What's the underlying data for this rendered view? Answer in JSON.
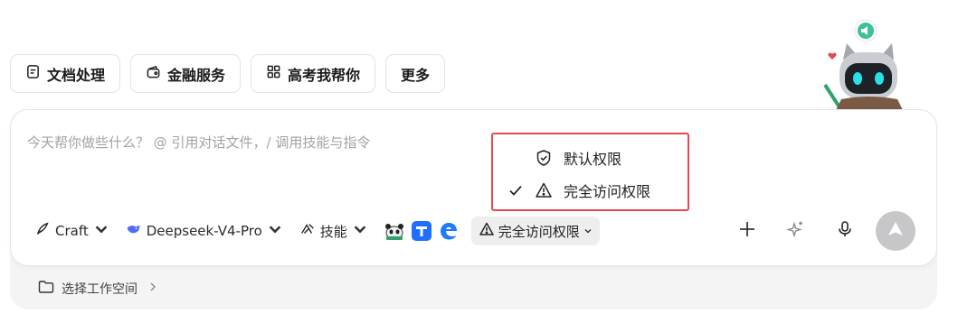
{
  "chips": [
    {
      "label": "文档处理",
      "icon": "document-icon"
    },
    {
      "label": "金融服务",
      "icon": "wallet-icon"
    },
    {
      "label": "高考我帮你",
      "icon": "grid-icon"
    },
    {
      "label": "更多",
      "icon": ""
    }
  ],
  "input": {
    "placeholder": "今天帮你做些什么？ @ 引用对话文件，/ 调用技能与指令"
  },
  "toolbar": {
    "mode_label": "Craft",
    "model_label": "Deepseek-V4-Pro",
    "skills_label": "技能",
    "permission_label": "完全访问权限"
  },
  "dropdown": {
    "items": [
      {
        "label": "默认权限",
        "icon": "shield-check-icon",
        "checked": false
      },
      {
        "label": "完全访问权限",
        "icon": "warning-triangle-icon",
        "checked": true
      }
    ]
  },
  "workspace": {
    "label": "选择工作空间"
  },
  "colors": {
    "accent_red": "#e5484d",
    "send_button": "#c7c7c9",
    "mascot_badge": "#3cc29a"
  }
}
